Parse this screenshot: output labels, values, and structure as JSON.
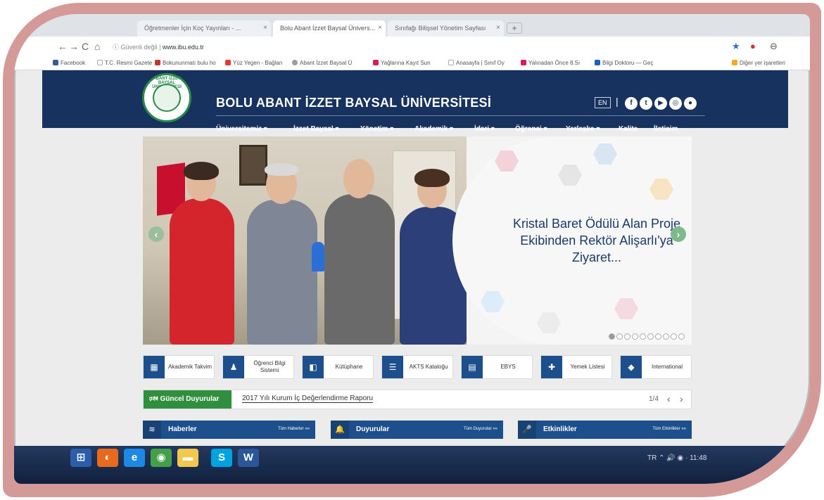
{
  "browser": {
    "tabs": [
      {
        "label": "Öğretmenler İçin Koç Yayınları - ..."
      },
      {
        "label": "Bolu Abant İzzet Baysal Ünivers..."
      },
      {
        "label": "Sınıfağı Bilişsel Yönetim Sayfası"
      }
    ],
    "new_tab": "+",
    "back": "←",
    "forward": "→",
    "reload": "C",
    "home": "⌂",
    "security_text": "ⓘ Güvenli değil",
    "url": "www.ibu.edu.tr",
    "bookmarks": [
      {
        "label": "Facebook",
        "color": "#3b5998"
      },
      {
        "label": "T.C. Resmi Gazete",
        "color": "#cccccc"
      },
      {
        "label": "Bokununmatı bulu ho",
        "color": "#c0392b"
      },
      {
        "label": "Yüz Yegen - Bağlan",
        "color": "#e53935"
      },
      {
        "label": "Abant İzzet Baysal Ü",
        "color": "#9e9e9e"
      },
      {
        "label": "Yağlarına Kayıt Sun",
        "color": "#d81b60"
      },
      {
        "label": "Anasayfa | Sınıf Oy",
        "color": "#cccccc"
      },
      {
        "label": "Yalınadan Önce 8.Sı",
        "color": "#d81b60"
      },
      {
        "label": "Bilgi Doktoru — Geç",
        "color": "#1565c0"
      },
      {
        "label": "Diğer yer işaretleri",
        "color": "#f9a825"
      }
    ]
  },
  "site": {
    "logo_text": "ABANT İZZET BAYSAL ÜNİVERSİTESİ",
    "title": "BOLU ABANT İZZET BAYSAL ÜNİVERSİTESİ",
    "lang": "EN",
    "lang_separator": "|",
    "social": [
      "f",
      "t",
      "▶",
      "◎",
      "●"
    ],
    "menu": [
      "Üniversitemiz ▾",
      "İzzet Baysal ▾",
      "Yönetim ▾",
      "Akademik ▾",
      "İdari ▾",
      "Öğrenci ▾",
      "Yerleşke ▾",
      "Kalite",
      "İletişim"
    ]
  },
  "slider": {
    "caption": "Kristal Baret Ödülü Alan Proje Ekibinden Rektör Alişarlı'ya Ziyaret...",
    "prev": "‹",
    "next": "›",
    "slide_count": 10,
    "active_slide": 1
  },
  "quick_links": [
    {
      "icon": "▦",
      "label": "Akademik Takvim"
    },
    {
      "icon": "♟",
      "label": "Öğrenci Bilgi Sistemi"
    },
    {
      "icon": "◧",
      "label": "Kütüphane"
    },
    {
      "icon": "☰",
      "label": "AKTS Kataloğu"
    },
    {
      "icon": "▤",
      "label": "EBYS"
    },
    {
      "icon": "✚",
      "label": "Yemek Listesi"
    },
    {
      "icon": "◆",
      "label": "International"
    }
  ],
  "announcements": {
    "label": "🕬 Güncel Duyurular",
    "text": "2017 Yılı Kurum İç Değerlendirme Raporu",
    "count": "1/4",
    "prev": "‹",
    "next": "›"
  },
  "sections": [
    {
      "icon": "≋",
      "title": "Haberler",
      "all": "Tüm Haberler »»"
    },
    {
      "icon": "🔔",
      "title": "Duyurular",
      "all": "Tüm Duyurular »»"
    },
    {
      "icon": "🎤",
      "title": "Etkinlikler",
      "all": "Tüm Etkinlikler »»"
    }
  ],
  "taskbar": {
    "apps": [
      {
        "glyph": "⊞",
        "color": "#2a5daa"
      },
      {
        "glyph": "◐",
        "color": "#e86a1c"
      },
      {
        "glyph": "e",
        "color": "#1e88e5"
      },
      {
        "glyph": "◉",
        "color": "#43a047"
      },
      {
        "glyph": "▬",
        "color": "#f2c94c"
      },
      {
        "glyph": "S",
        "color": "#00a3e0"
      },
      {
        "glyph": "W",
        "color": "#2b579a"
      }
    ],
    "tray_text": "TR ⌃ 🔊 ◉ · 11:48"
  },
  "colors": {
    "header_navy": "#17325f",
    "frame_rose": "#d39a98",
    "announcement_green": "#2f8f3f",
    "section_blue": "#1d4f8c"
  }
}
